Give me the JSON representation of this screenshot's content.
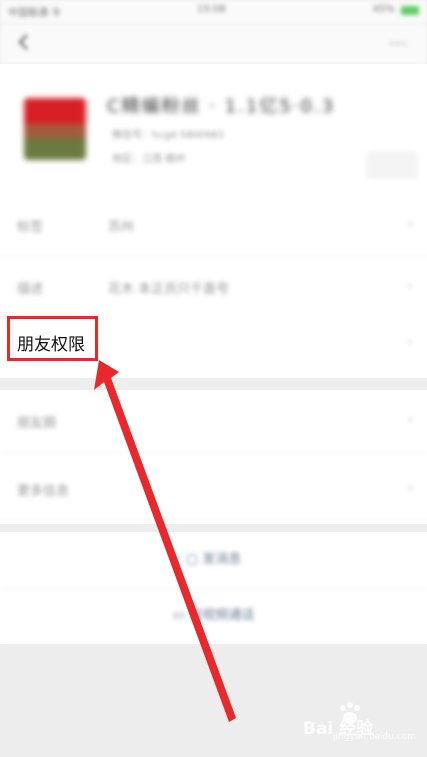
{
  "status_bar": {
    "carrier": "中国联通 令",
    "time": "15:08",
    "battery": "45%"
  },
  "nav": {
    "more_label": "···"
  },
  "profile": {
    "nickname": "C精编粉丝 · 1.1亿5·0.3",
    "wxid": "微信号：hcgd 5800983",
    "region": "地区：江西 赣州"
  },
  "rows": [
    {
      "label": "标签",
      "value": "苏州"
    },
    {
      "label": "描述",
      "value": "花木 本正员只千直号"
    },
    {
      "label": "朋友权限",
      "value": ""
    }
  ],
  "rows2": [
    {
      "label": "朋友圈",
      "value": ""
    },
    {
      "label": "更多信息",
      "value": ""
    }
  ],
  "actions": [
    {
      "label": "发消息"
    },
    {
      "label": "音视频通话"
    }
  ],
  "annotation": {
    "color": "#e8282b"
  },
  "watermark": {
    "brand": "Bai 经验",
    "url": "jingyan.baidu.com"
  }
}
